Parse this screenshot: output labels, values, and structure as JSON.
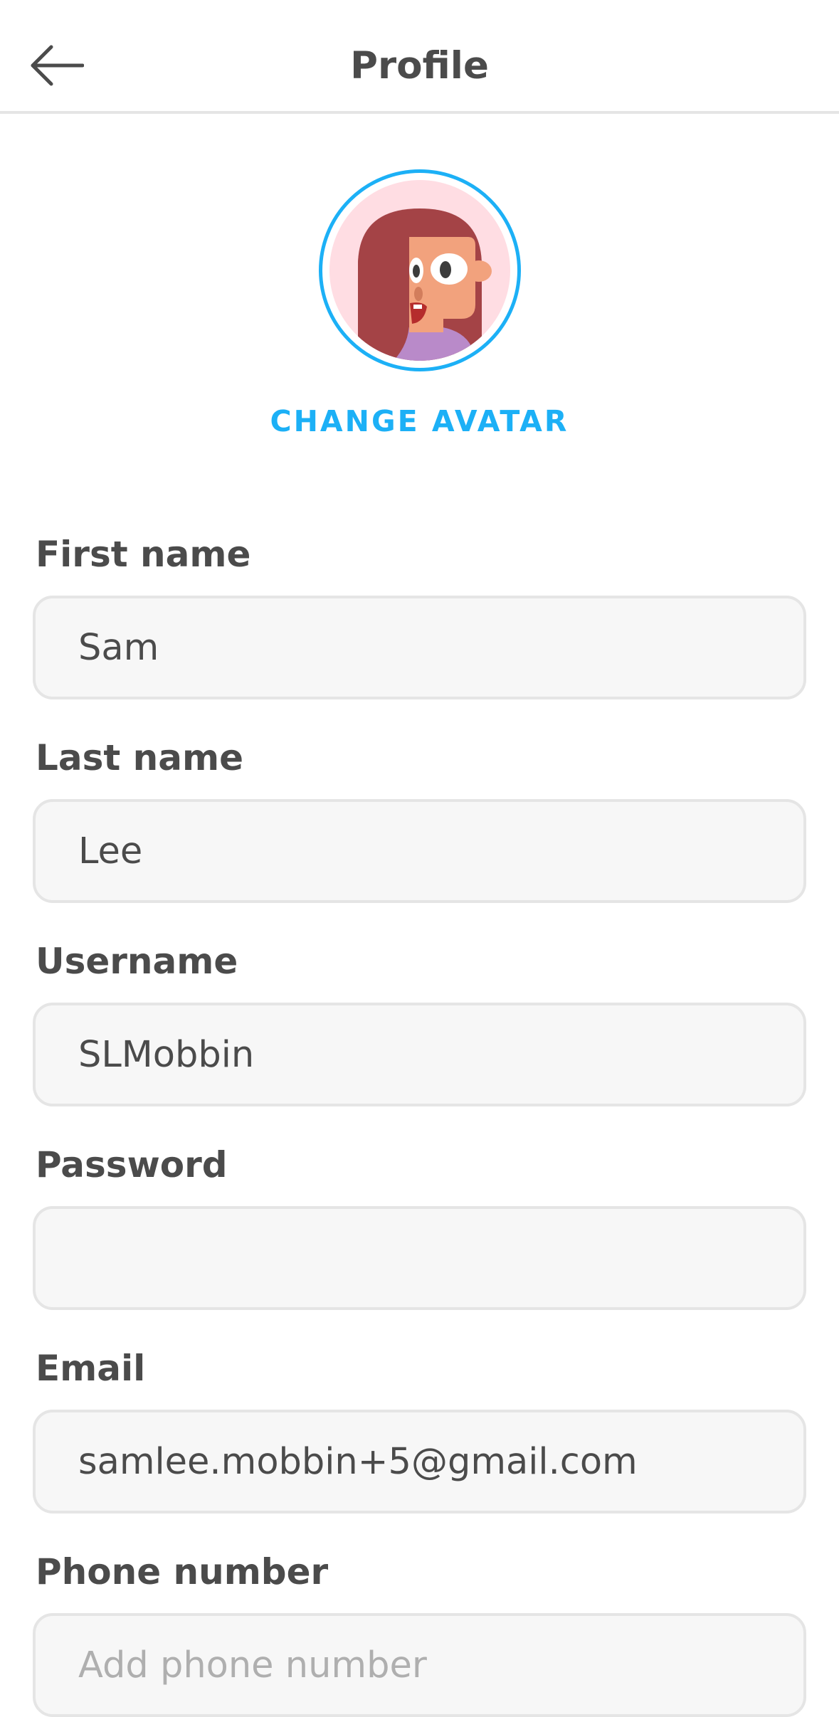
{
  "header": {
    "title": "Profile",
    "back_icon": "arrow-left-icon"
  },
  "avatar": {
    "change_label": "CHANGE AVATAR",
    "ring_color": "#1cb0f6"
  },
  "form": {
    "first_name": {
      "label": "First name",
      "value": "Sam"
    },
    "last_name": {
      "label": "Last name",
      "value": "Lee"
    },
    "username": {
      "label": "Username",
      "value": "SLMobbin"
    },
    "password": {
      "label": "Password",
      "value": ""
    },
    "email": {
      "label": "Email",
      "value": "samlee.mobbin+5@gmail.com"
    },
    "phone": {
      "label": "Phone number",
      "value": "",
      "placeholder": "Add phone number"
    }
  }
}
